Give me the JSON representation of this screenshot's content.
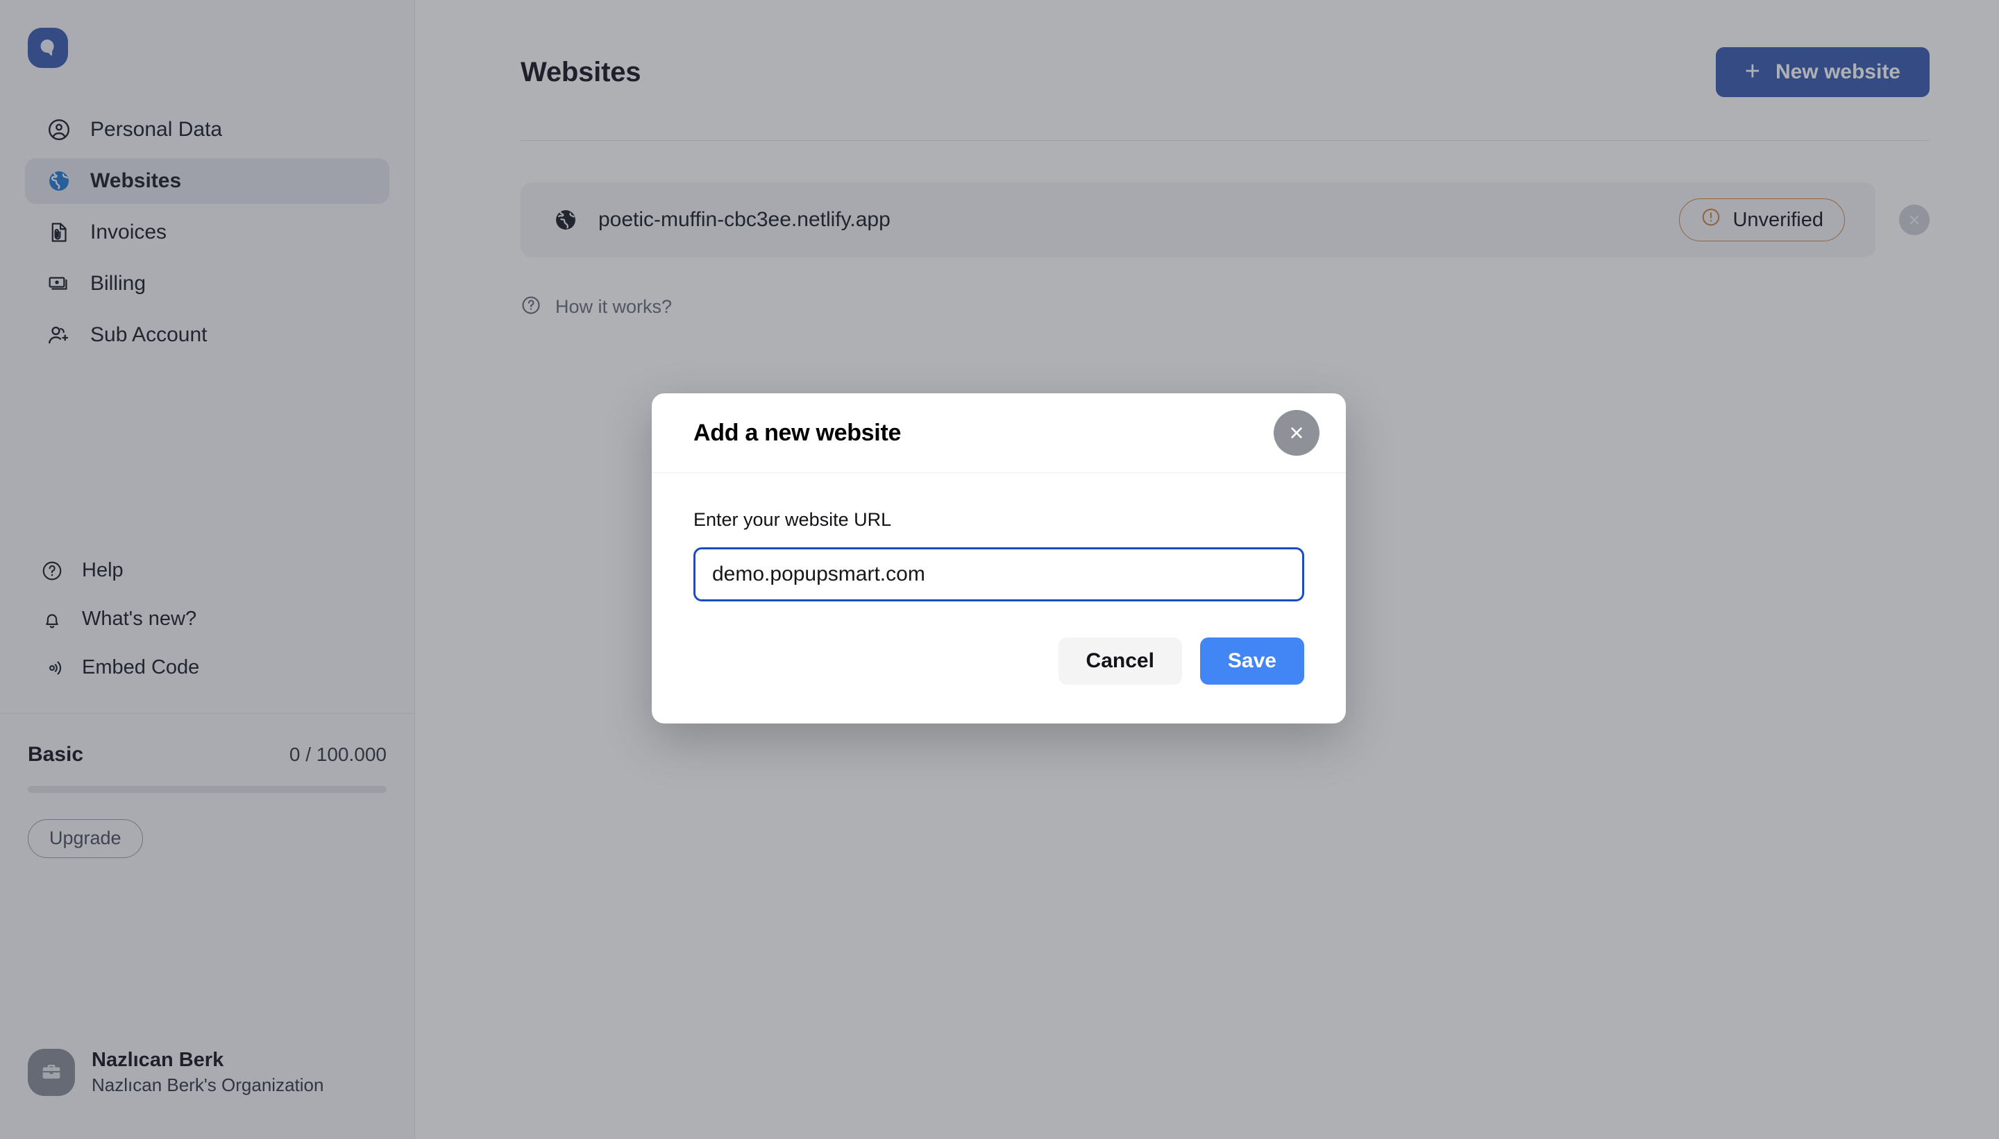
{
  "app": {
    "logo_icon": "popupsmart-logo-icon",
    "brand_color": "#3f62b4"
  },
  "sidebar": {
    "items": [
      {
        "label": "Personal Data",
        "icon": "user-circle-icon",
        "active": false
      },
      {
        "label": "Websites",
        "icon": "globe-icon",
        "active": true
      },
      {
        "label": "Invoices",
        "icon": "document-clip-icon",
        "active": false
      },
      {
        "label": "Billing",
        "icon": "banknotes-icon",
        "active": false
      },
      {
        "label": "Sub Account",
        "icon": "user-plus-icon",
        "active": false
      }
    ],
    "bottom_items": [
      {
        "label": "Help",
        "icon": "question-circle-icon"
      },
      {
        "label": "What's new?",
        "icon": "bell-icon"
      },
      {
        "label": "Embed Code",
        "icon": "broadcast-icon"
      }
    ],
    "plan": {
      "name": "Basic",
      "quota": "0 / 100.000",
      "progress_percent": 0,
      "upgrade_label": "Upgrade"
    },
    "account": {
      "name": "Nazlıcan Berk",
      "organization": "Nazlıcan Berk's Organization",
      "avatar_icon": "briefcase-icon"
    }
  },
  "main": {
    "page_title": "Websites",
    "new_website_label": "New website",
    "new_website_icon": "plus-icon",
    "websites": [
      {
        "url": "poetic-muffin-cbc3ee.netlify.app",
        "icon": "globe-icon",
        "status_label": "Unverified",
        "status_icon": "exclamation-circle-icon",
        "status_color": "#d08a4e",
        "remove_icon": "close-icon"
      }
    ],
    "how_it_works_label": "How it works?",
    "how_it_works_icon": "question-circle-icon"
  },
  "modal": {
    "title": "Add a new website",
    "close_icon": "close-icon",
    "field_label": "Enter your website URL",
    "input_value": "demo.popupsmart.com",
    "input_placeholder": "Enter your website URL",
    "cancel_label": "Cancel",
    "save_label": "Save",
    "save_color": "#4285f4",
    "focus_border_color": "#1a4bc4"
  }
}
